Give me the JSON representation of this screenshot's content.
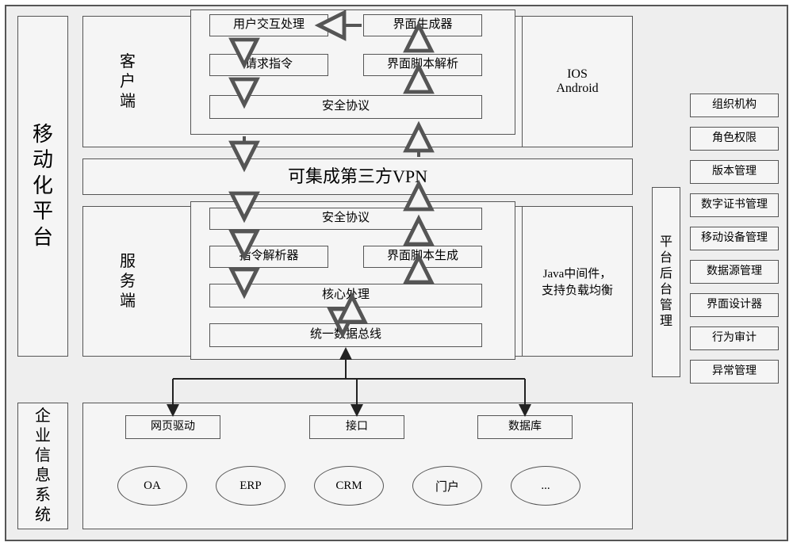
{
  "title_left": "移动化平台",
  "enterprise_title": "企业信息系统",
  "backend_title": "平台后台管理",
  "client_label": "客户端",
  "server_label": "服务端",
  "vpn": "可集成第三方VPN",
  "client": {
    "user_interact": "用户交互处理",
    "ui_generator": "界面生成器",
    "request_cmd": "请求指令",
    "ui_script_parse": "界面脚本解析",
    "security": "安全协议",
    "platforms": "IOS\nAndroid"
  },
  "server": {
    "security": "安全协议",
    "cmd_parser": "指令解析器",
    "ui_script_gen": "界面脚本生成",
    "core": "核心处理",
    "databus": "统一数据总线",
    "middleware": "Java中间件，\n支持负载均衡"
  },
  "enterprise": {
    "web_driver": "网页驱动",
    "api": "接口",
    "database": "数据库",
    "systems": [
      "OA",
      "ERP",
      "CRM",
      "门户",
      "..."
    ]
  },
  "backend_items": [
    "组织机构",
    "角色权限",
    "版本管理",
    "数字证书管理",
    "移动设备管理",
    "数据源管理",
    "界面设计器",
    "行为审计",
    "异常管理"
  ]
}
